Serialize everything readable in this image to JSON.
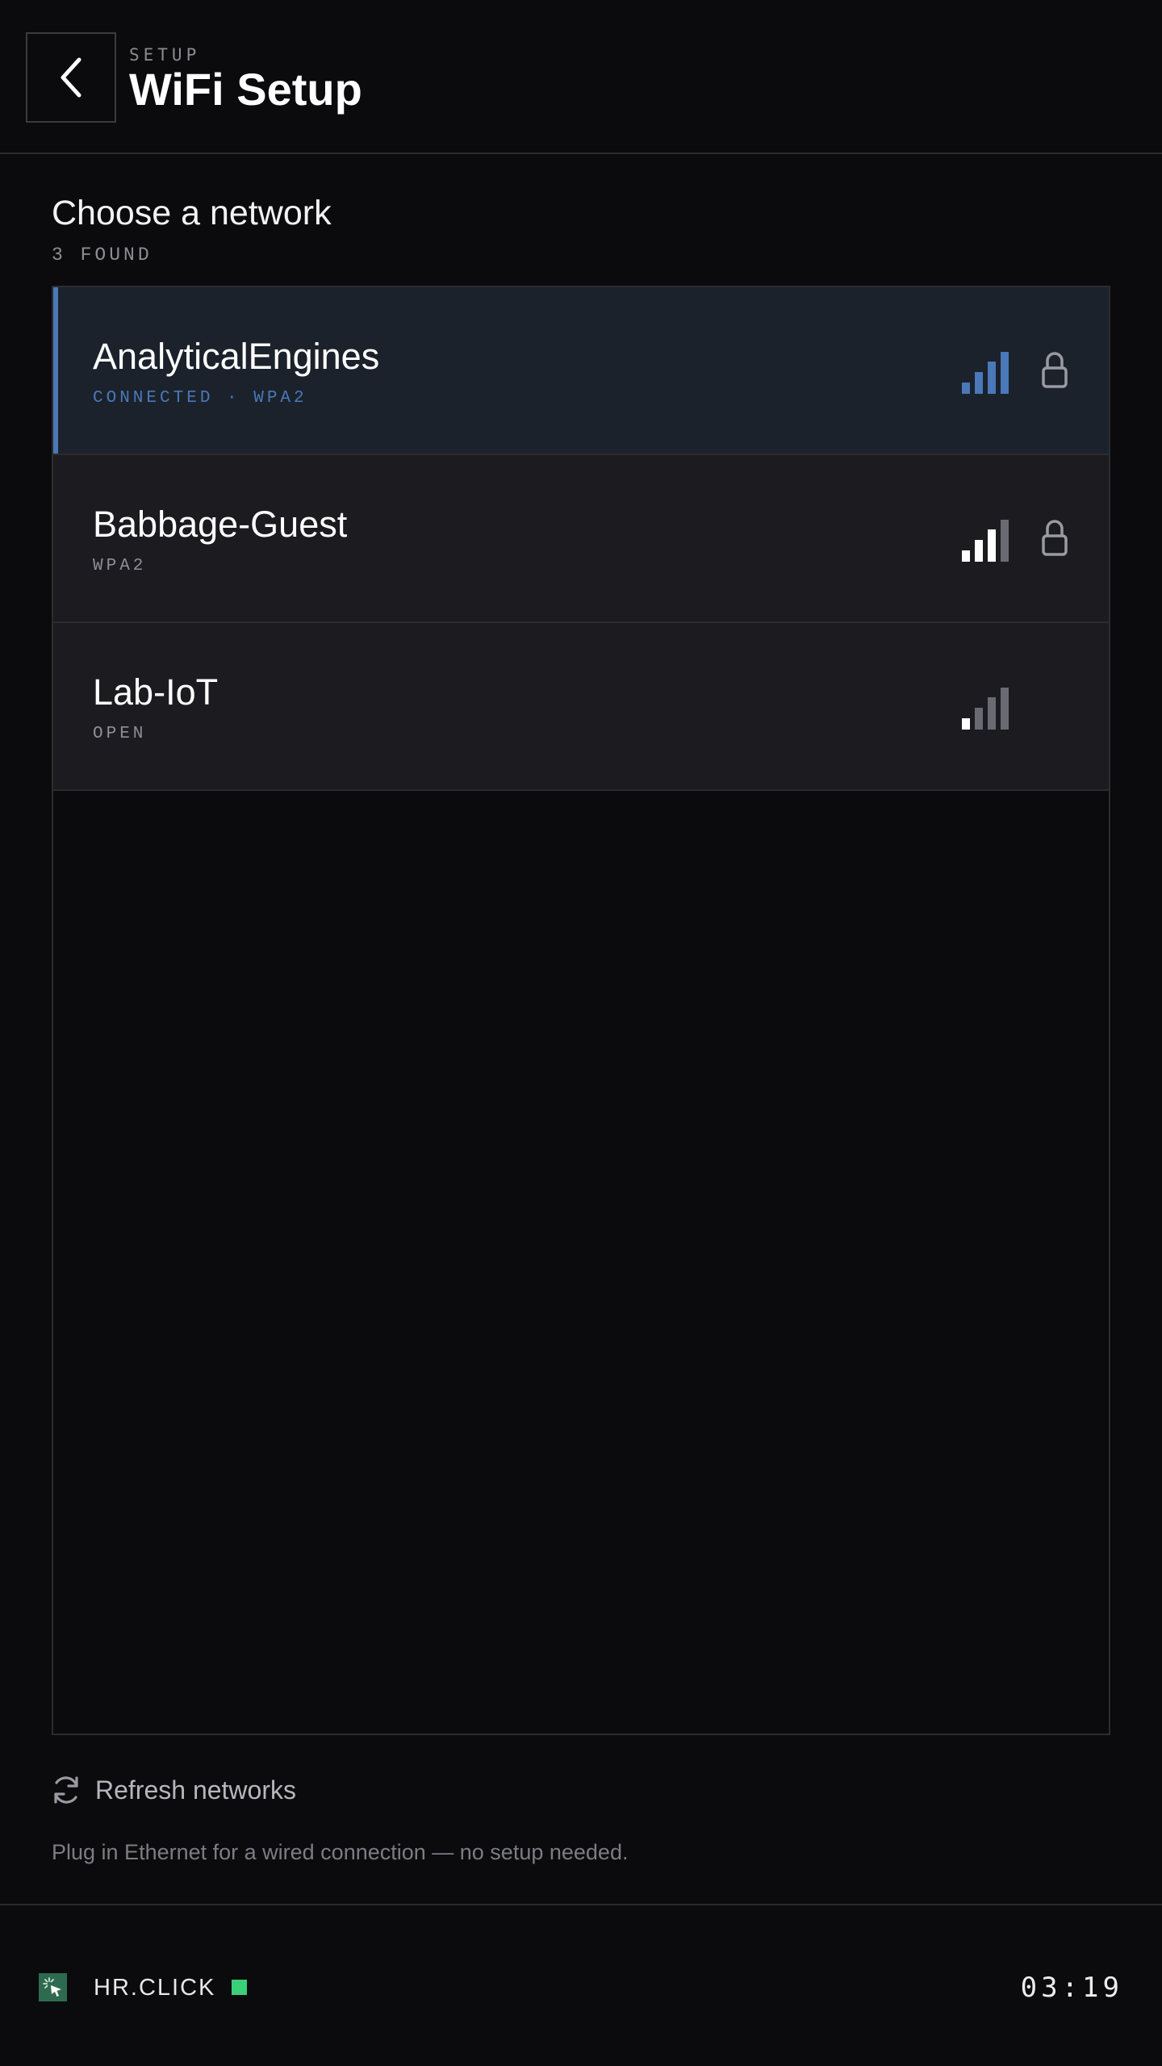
{
  "header": {
    "back_icon": "chevron-left-icon",
    "eyebrow": "SETUP",
    "title": "WiFi Setup"
  },
  "section": {
    "title": "Choose a network",
    "found": "3 FOUND"
  },
  "networks": [
    {
      "name": "AnalyticalEngines",
      "subtitle": "CONNECTED · WPA2",
      "connected": true,
      "secured": true,
      "signal_bars": 4,
      "signal_max": 4
    },
    {
      "name": "Babbage-Guest",
      "subtitle": "WPA2",
      "connected": false,
      "secured": true,
      "signal_bars": 3,
      "signal_max": 4
    },
    {
      "name": "Lab-IoT",
      "subtitle": "OPEN",
      "connected": false,
      "secured": false,
      "signal_bars": 1,
      "signal_max": 4
    }
  ],
  "refresh": {
    "icon": "refresh-icon",
    "label": "Refresh networks"
  },
  "hint": "Plug in Ethernet for a wired connection — no setup needed.",
  "footer": {
    "brand_icon": "cursor-click-icon",
    "brand": "HR.CLICK",
    "status": "online",
    "time": "03:19"
  },
  "colors": {
    "background": "#0b0b0d",
    "accent": "#4a78b8",
    "row": "#1c1c20",
    "row_active": "#1b222c",
    "status_green": "#3ccf7a"
  }
}
